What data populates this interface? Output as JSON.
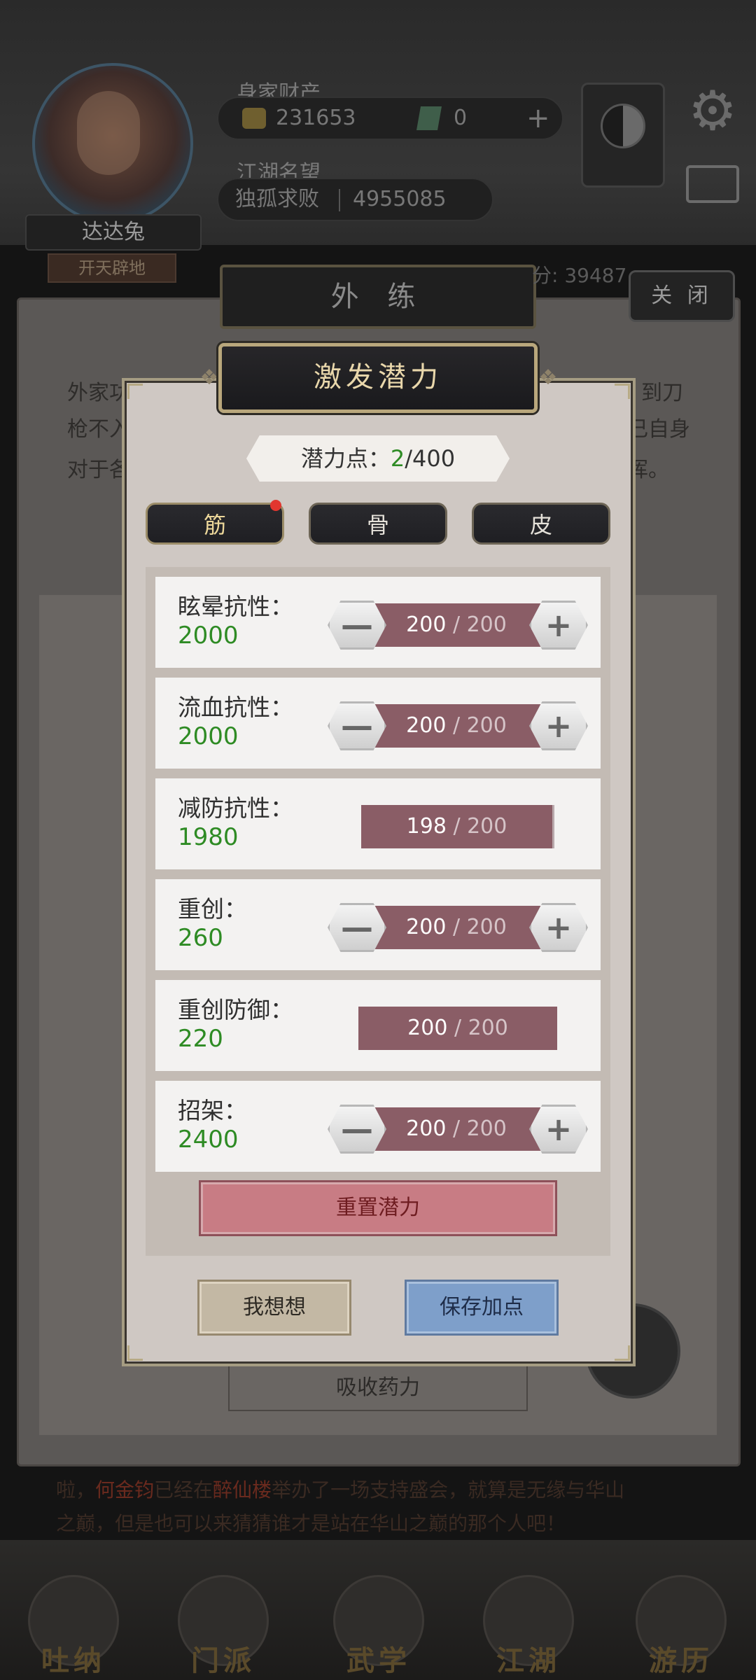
{
  "background": {
    "player_name": "达达兔",
    "player_title": "开天辟地",
    "assets_label": "身家财产",
    "gold_amount": "231653",
    "gem_amount": "0",
    "plus_sign": "+",
    "reputation_label": "江湖名望",
    "reputation_rank": "独孤求败",
    "reputation_value": "4955085",
    "panel_tab_title": "外 练",
    "close_label": "关 闭",
    "score_fragment": "分: 39487",
    "desc_line1_left": "外家功",
    "desc_line1_right": "到刀",
    "desc_line2_left": "枪不入",
    "desc_line2_right": "己自身",
    "desc_line3_left": "对于各",
    "desc_line3_right": "挥。",
    "absorb_label": "吸收药力",
    "marquee_prefix": "啦，",
    "marquee_name1": "何金钧",
    "marquee_mid1": "已经在",
    "marquee_place": "醉仙楼",
    "marquee_mid2": "举办了一场支持盛会，就算是无缘与华山",
    "marquee_line2": "之巅，但是也可以来猜猜谁才是站在华山之巅的那个人吧！",
    "nav": [
      "吐纳",
      "门派",
      "武学",
      "江湖",
      "游历"
    ]
  },
  "modal": {
    "title": "激发潜力",
    "potential_label": "潜力点：",
    "potential_current": "2",
    "potential_total": "/400",
    "tabs": [
      "筋",
      "骨",
      "皮"
    ],
    "active_tab": "筋",
    "stats": [
      {
        "name": "眩晕抗性：",
        "value": "2000",
        "current": "200",
        "sep": " / ",
        "max": "200",
        "steppers": true,
        "fill": 1.0
      },
      {
        "name": "流血抗性：",
        "value": "2000",
        "current": "200",
        "sep": " / ",
        "max": "200",
        "steppers": true,
        "fill": 1.0
      },
      {
        "name": "减防抗性：",
        "value": "1980",
        "current": "198",
        "sep": " / ",
        "max": "200",
        "steppers": false,
        "fill": 0.99
      },
      {
        "name": "重创：",
        "value": "260",
        "current": "200",
        "sep": " / ",
        "max": "200",
        "steppers": true,
        "fill": 1.0
      },
      {
        "name": "重创防御：",
        "value": "220",
        "current": "200",
        "sep": " / ",
        "max": "200",
        "steppers": false,
        "fill": 1.0
      },
      {
        "name": "招架：",
        "value": "2400",
        "current": "200",
        "sep": " / ",
        "max": "200",
        "steppers": true,
        "fill": 1.0
      }
    ],
    "reset_label": "重置潜力",
    "think_label": "我想想",
    "save_label": "保存加点",
    "minus_symbol": "—",
    "plus_symbol": "+"
  },
  "colors": {
    "accent_green": "#2e8b24",
    "bar_fill": "#8a5d66",
    "reset_button": "#c87c84",
    "save_button": "#7e9fca"
  }
}
